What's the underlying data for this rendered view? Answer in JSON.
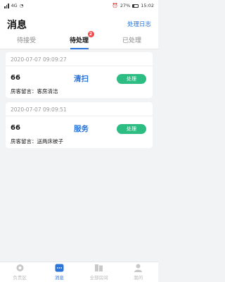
{
  "status_bar": {
    "left_info": "4G",
    "right_info": "27%",
    "time": "15:02"
  },
  "header": {
    "title": "消息",
    "log_link": "处理日志"
  },
  "tabs": [
    {
      "label": "待接受",
      "active": false
    },
    {
      "label": "待处理",
      "active": true,
      "badge": "2"
    },
    {
      "label": "已处理",
      "active": false
    }
  ],
  "cards": [
    {
      "time": "2020-07-07 09:09:27",
      "room": "66",
      "type": "清扫",
      "action": "处理",
      "note": "房客留言：客房清洁"
    },
    {
      "time": "2020-07-07 09:09:51",
      "room": "66",
      "type": "服务",
      "action": "处理",
      "note": "房客留言：送两床被子"
    }
  ],
  "tabbar": [
    {
      "label": "负责区",
      "icon": "area-icon",
      "active": false
    },
    {
      "label": "消息",
      "icon": "message-icon",
      "active": true
    },
    {
      "label": "全部房间",
      "icon": "rooms-icon",
      "active": false
    },
    {
      "label": "我的",
      "icon": "profile-icon",
      "active": false
    }
  ],
  "colors": {
    "accent": "#2b74d9",
    "action_green": "#2dbd83",
    "badge_red": "#f04a4a"
  }
}
